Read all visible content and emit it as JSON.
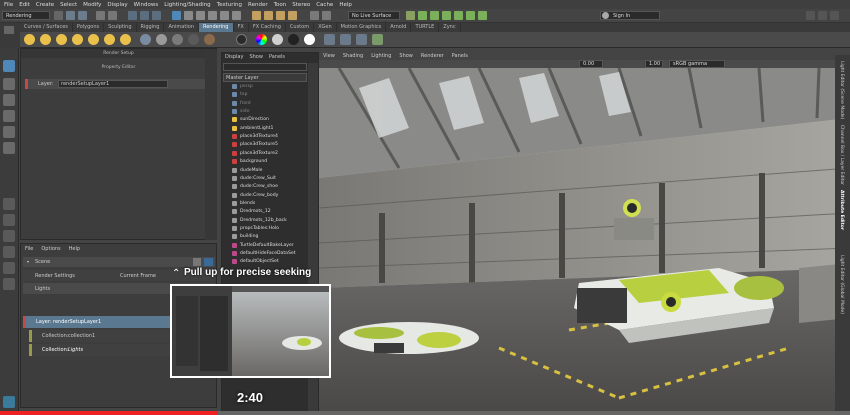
{
  "menu": [
    "File",
    "Edit",
    "Create",
    "Select",
    "Modify",
    "Display",
    "Windows",
    "Lighting/Shading",
    "Texturing",
    "Render",
    "Toon",
    "Stereo",
    "Cache",
    "Help"
  ],
  "status_line": {
    "mode_dropdown": "Rendering",
    "live_surface": "No Live Surface",
    "sign_in": "Sign In"
  },
  "shelf_tabs": [
    "Curves / Surfaces",
    "Polygons",
    "Sculpting",
    "Rigging",
    "Animation",
    "Rendering",
    "FX",
    "FX Caching",
    "Custom",
    "XGen",
    "Motion Graphics",
    "Arnold",
    "TURTLE",
    "Zync"
  ],
  "active_shelf_tab": "Rendering",
  "render_setup": {
    "title": "Render Setup",
    "property_editor_title": "Property Editor",
    "layer_label": "Layer:",
    "layer_value": "renderSetupLayer1",
    "menu": [
      "File",
      "Options",
      "Help"
    ],
    "scene_label": "Scene",
    "render_settings_label": "Render Settings",
    "current_frame_label": "Current Frame",
    "lights_label": "Lights",
    "tree": {
      "layer_label": "Layer:",
      "layer_value": "renderSetupLayer1",
      "collection1_label": "Collection:",
      "collection1_value": "collection1",
      "collection2_label": "Collection:",
      "collection2_value": "Lights"
    }
  },
  "outliner": {
    "menu": [
      "Display",
      "Show",
      "Panels"
    ],
    "master_layer": "Master Layer",
    "items": [
      {
        "label": "persp",
        "kind": "cam"
      },
      {
        "label": "top",
        "kind": "cam"
      },
      {
        "label": "front",
        "kind": "cam"
      },
      {
        "label": "side",
        "kind": "cam"
      },
      {
        "label": "sunDirection",
        "kind": "light"
      },
      {
        "label": "ambientLight1",
        "kind": "light"
      },
      {
        "label": "place3dTexture4",
        "kind": "tex"
      },
      {
        "label": "place3dTexture5",
        "kind": "tex"
      },
      {
        "label": "place3dTexture2",
        "kind": "tex"
      },
      {
        "label": "background",
        "kind": "tex"
      },
      {
        "label": "dudeMale",
        "kind": "mesh"
      },
      {
        "label": "dude:Crew_Suit",
        "kind": "mesh"
      },
      {
        "label": "dude:Crew_shoe",
        "kind": "mesh"
      },
      {
        "label": "dude:Crew_body",
        "kind": "mesh"
      },
      {
        "label": "blends",
        "kind": "mesh"
      },
      {
        "label": "Dredmots_12",
        "kind": "mesh"
      },
      {
        "label": "Dredmots_12b_back",
        "kind": "mesh"
      },
      {
        "label": "propsTables:Holo",
        "kind": "mesh"
      },
      {
        "label": "building",
        "kind": "mesh"
      },
      {
        "label": "TurtleDefaultBakeLayer",
        "kind": "set"
      },
      {
        "label": "defaultHideFaceDataSet",
        "kind": "set"
      },
      {
        "label": "defaultObjectSet",
        "kind": "set"
      }
    ]
  },
  "viewport": {
    "menu": [
      "View",
      "Shading",
      "Lighting",
      "Show",
      "Renderer",
      "Panels"
    ],
    "near_value": "0.00",
    "far_value": "1.00",
    "color_space": "sRGB gamma"
  },
  "right_tabs": [
    "Light Editor (Scene Mode)",
    "Channel Box / Layer Editor",
    "Attribute Editor",
    "Light Editor (Global Mode)"
  ],
  "video_overlay": {
    "seek_hint": "Pull up for precise seeking",
    "timestamp": "2:40"
  },
  "colors": {
    "accent_blue": "#5a7890",
    "layer_red": "#c44a4a",
    "collection_olive": "#9a9a4a",
    "viewport_header": "#4a4a4a"
  }
}
